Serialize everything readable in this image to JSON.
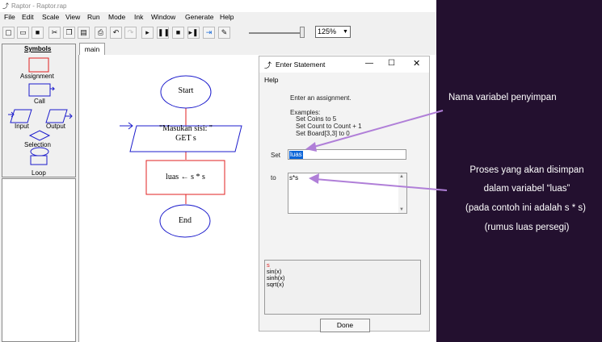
{
  "window": {
    "title": "Raptor - Raptor.rap"
  },
  "menu": [
    "File",
    "Edit",
    "Scale",
    "View",
    "Run",
    "Mode",
    "Ink",
    "Window",
    "Generate",
    "Help"
  ],
  "toolbar": {
    "zoom_value": "125%"
  },
  "symbols": {
    "header": "Symbols",
    "items": [
      "Assignment",
      "Call",
      "Input",
      "Output",
      "Selection",
      "Loop"
    ]
  },
  "tabs": [
    "main"
  ],
  "flowchart": {
    "start": "Start",
    "input_line1": "\"Masukan sisi: \"",
    "input_line2": "GET s",
    "assignment": "luas ← s * s",
    "end": "End"
  },
  "dialog": {
    "title": "Enter Statement",
    "menu_help": "Help",
    "instruction": "Enter an assignment.",
    "examples_header": "Examples:",
    "examples": [
      "Set Coins to 5",
      "Set Count to Count + 1",
      "Set Board[3,3] to 0"
    ],
    "set_label": "Set",
    "set_value": "luas",
    "to_label": "to",
    "to_value": "s*s",
    "functions": [
      "s",
      "sin(x)",
      "sinh(x)",
      "sqrt(x)"
    ],
    "done_label": "Done"
  },
  "annotations": {
    "variable_note": "Nama variabel penyimpan",
    "process_line1": "Proses yang akan disimpan",
    "process_line2": "dalam variabel “luas”",
    "process_line3": "(pada contoh ini adalah s * s)",
    "process_line4": "(rumus luas persegi)"
  },
  "colors": {
    "flow_blue": "#1c1ccc",
    "flow_red": "#e02020",
    "arrow_purple": "#b07fd8",
    "panel_dark": "#23102f",
    "selection_blue": "#0a64d8"
  }
}
